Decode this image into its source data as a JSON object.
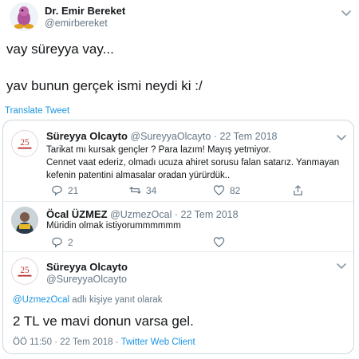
{
  "main_tweet": {
    "author_name": "Dr. Emir Bereket",
    "author_handle": "@emirbereket",
    "text_line1": "vay süreyya vay...",
    "text_line2": "yav bunun gerçek ismi neydi ki :/",
    "translate_label": "Translate Tweet"
  },
  "quoted_thread": {
    "tweet1": {
      "author_name": "Süreyya Olcayto",
      "author_handle": "@SureyyaOlcayto",
      "sep": "·",
      "date": "22 Tem 2018",
      "text_line1": "Tarikat mı kursak gençler ? Para lazım! Mayış yetmiyor.",
      "text_line2": "Cennet vaat ederiz, olmadı ucuza ahiret sorusu falan satarız. Yanmayan",
      "text_line3": "kefenin patentini almasalar oradan yürürdük..",
      "replies": "21",
      "retweets": "34",
      "likes": "82"
    },
    "tweet2": {
      "author_name": "Öcal ÜZMEZ",
      "author_handle": "@UzmezOcal",
      "sep": "·",
      "date": "22 Tem 2018",
      "text": "Müridin olmak istiyorummmmmm",
      "replies": "2"
    },
    "tweet3": {
      "author_name": "Süreyya Olcayto",
      "author_handle": "@SureyyaOlcayto",
      "reply_to_handle": "@UzmezOcal",
      "reply_to_suffix": " adlı kişiye yanıt olarak",
      "text": "2 TL ve mavi donun varsa gel.",
      "time": "ÖÖ 11:50",
      "sep": "·",
      "date": "22 Tem 2018",
      "source": "Twitter Web Client"
    }
  },
  "icons": [
    "chevron-down-icon",
    "reply-icon",
    "retweet-icon",
    "like-icon",
    "share-icon"
  ],
  "colors": {
    "link": "#1b95e0",
    "muted": "#657786",
    "text": "#14171a"
  }
}
